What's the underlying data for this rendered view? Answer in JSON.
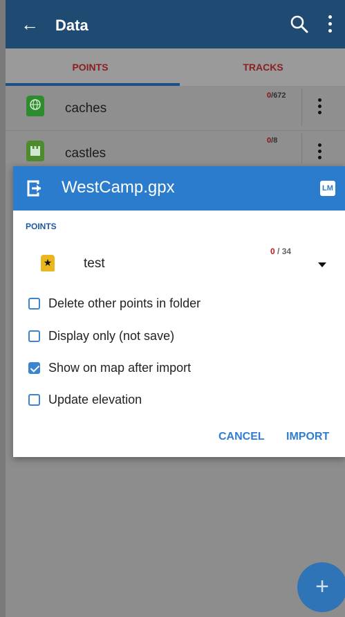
{
  "app_bar": {
    "title": "Data"
  },
  "tabs": [
    {
      "label": "POINTS",
      "active": true
    },
    {
      "label": "TRACKS",
      "active": false
    }
  ],
  "list": [
    {
      "name": "caches",
      "count_selected": "0",
      "count_sep": "/",
      "count_total": "672",
      "icon": "globe-marker-icon",
      "color": "#2e8b2e"
    },
    {
      "name": "castles",
      "count_selected": "0",
      "count_sep": "/",
      "count_total": "8",
      "icon": "castle-marker-icon",
      "color": "#4e8b2e"
    }
  ],
  "dialog": {
    "filename": "WestCamp.gpx",
    "section_label": "POINTS",
    "folder": {
      "name": "test",
      "count_selected": "0",
      "count_sep": " / ",
      "count_total": "34"
    },
    "options": [
      {
        "label": "Delete other points in folder",
        "checked": false
      },
      {
        "label": "Display only (not save)",
        "checked": false
      },
      {
        "label": "Show on map after import",
        "checked": true
      },
      {
        "label": "Update elevation",
        "checked": false
      }
    ],
    "cancel_label": "CANCEL",
    "import_label": "IMPORT"
  },
  "fab_label": "+",
  "colors": {
    "appbar": "#1f4a72",
    "dialog_header": "#2b7ccc",
    "accent": "#2f7dd0",
    "selected_count": "#c01818"
  }
}
